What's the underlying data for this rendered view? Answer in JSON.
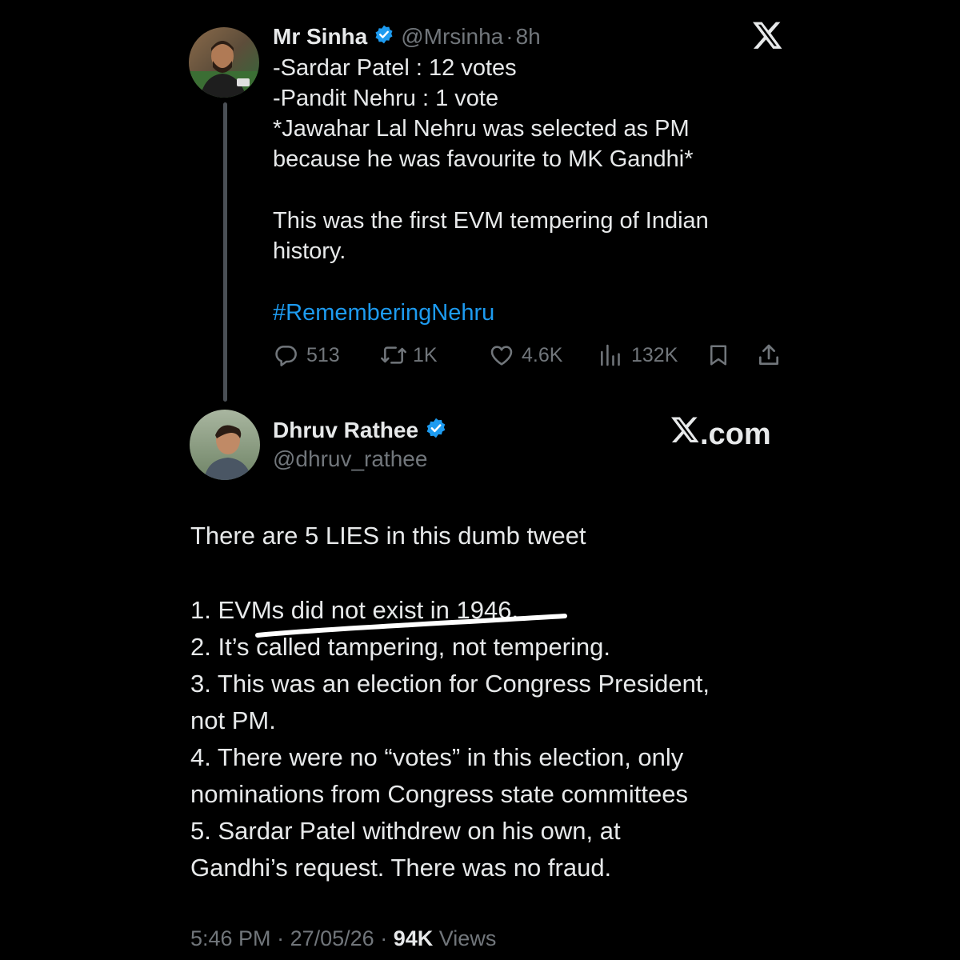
{
  "original_tweet": {
    "author": {
      "display_name": "Mr Sinha",
      "handle": "@Mrsinha",
      "separator": "·",
      "time_ago": "8h",
      "avatar_icon": "profile-photo"
    },
    "lines": [
      "-Sardar Patel : 12 votes",
      "-Pandit Nehru : 1 vote",
      "*Jawahar Lal Nehru was selected as PM",
      "because he was favourite to MK Gandhi*",
      "This was the first EVM tempering of Indian",
      "history."
    ],
    "hashtag": "#RememberingNehru",
    "actions": {
      "replies": "513",
      "reposts": "1K",
      "likes": "4.6K",
      "views": "132K"
    }
  },
  "reply_tweet": {
    "author": {
      "display_name": "Dhruv Rathee",
      "handle": "@dhruv_rathee",
      "avatar_icon": "profile-photo"
    },
    "watermark": ".com",
    "lines": [
      "There are 5 LIES in this dumb tweet",
      "1.  EVMs did not exist in 1946.",
      "2. It’s called tampering, not tempering.",
      "3. This was an election for Congress President,",
      "not PM.",
      "4. There were no “votes” in this election, only",
      "nominations from Congress state committees",
      "5. Sardar Patel withdrew on his own, at",
      "Gandhi’s request. There was no fraud."
    ],
    "footer": {
      "time": "5:46 PM",
      "sep1": "·",
      "date": "27/05/26",
      "sep2": "·",
      "views_count": "94K",
      "views_label": "Views"
    }
  },
  "colors": {
    "background": "#000000",
    "text": "#e7e9ea",
    "secondary": "#71767b",
    "accent": "#1d9bf0",
    "thread_line": "#4a4f55"
  }
}
